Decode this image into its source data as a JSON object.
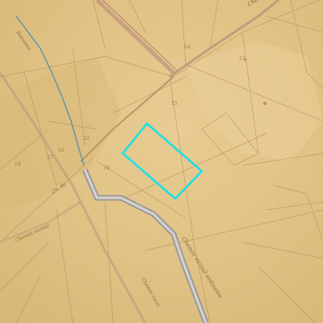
{
  "map": {
    "highlight_color": "#19e0e6",
    "stream_color": "#5b8fa6",
    "labels": {
      "top_right": "Che...",
      "left_creek": "Ruisseau",
      "mid_left": "Ch. de",
      "lower_left": "Chemin vicinal",
      "lower_center": "Chemin rural",
      "lower_right": "Chemin vicinal ordinaire"
    },
    "parcel_numbers": [
      "14",
      "15",
      "16",
      "17",
      "18",
      "19",
      "22",
      "23"
    ]
  }
}
